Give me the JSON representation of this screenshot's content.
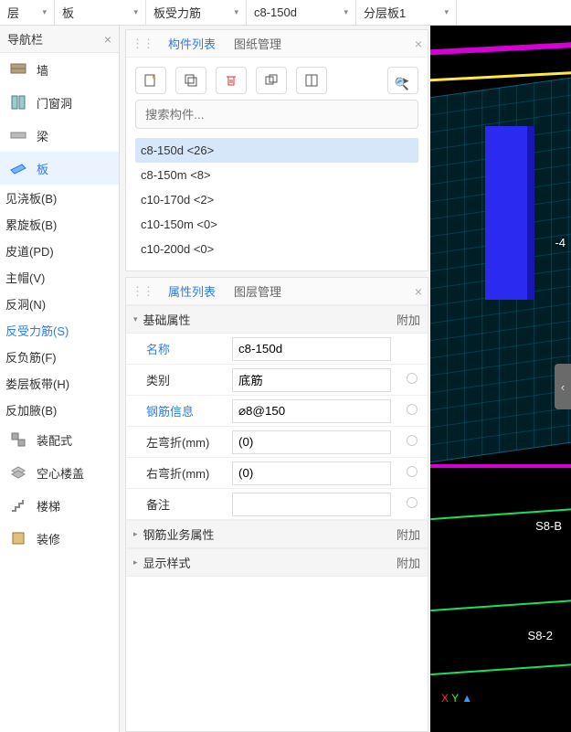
{
  "topbar": {
    "items": [
      "层",
      "板",
      "板受力筋",
      "c8-150d",
      "分层板1"
    ]
  },
  "sidebar": {
    "title": "导航栏",
    "items": [
      {
        "label": "墙",
        "icon": "wall"
      },
      {
        "label": "门窗洞",
        "icon": "door"
      },
      {
        "label": "梁",
        "icon": "beam"
      },
      {
        "label": "板",
        "icon": "slab",
        "active": true
      }
    ],
    "subs": [
      {
        "label": "见浇板(B)"
      },
      {
        "label": "累旋板(B)"
      },
      {
        "label": "皮道(PD)"
      },
      {
        "label": "主帽(V)"
      },
      {
        "label": "反洞(N)"
      },
      {
        "label": "反受力筋(S)",
        "active": true
      },
      {
        "label": "反负筋(F)"
      },
      {
        "label": "娄层板带(H)"
      },
      {
        "label": "反加腋(B)"
      }
    ],
    "lower": [
      {
        "label": "装配式",
        "icon": "prefab"
      },
      {
        "label": "空心楼盖",
        "icon": "hollow"
      },
      {
        "label": "楼梯",
        "icon": "stair"
      },
      {
        "label": "装修",
        "icon": "deco"
      }
    ]
  },
  "compPanel": {
    "tabs": [
      "构件列表",
      "图纸管理"
    ],
    "activeTab": 0,
    "searchPlaceholder": "搜索构件...",
    "items": [
      {
        "label": "c8-150d <26>",
        "selected": true
      },
      {
        "label": "c8-150m <8>"
      },
      {
        "label": "c10-170d <2>"
      },
      {
        "label": "c10-150m <0>"
      },
      {
        "label": "c10-200d <0>"
      }
    ]
  },
  "propPanel": {
    "tabs": [
      "属性列表",
      "图层管理"
    ],
    "activeTab": 0,
    "groups": [
      {
        "title": "基础属性",
        "extra": "附加",
        "open": true
      },
      {
        "title": "钢筋业务属性",
        "extra": "附加",
        "open": false
      },
      {
        "title": "显示样式",
        "extra": "附加",
        "open": false
      }
    ],
    "rows": [
      {
        "label": "名称",
        "link": true,
        "value": "c8-150d",
        "extraDot": false
      },
      {
        "label": "类别",
        "value": "底筋",
        "extraDot": true
      },
      {
        "label": "钢筋信息",
        "link": true,
        "value": "⌀8@150",
        "extraDot": true
      },
      {
        "label": "左弯折(mm)",
        "value": "(0)",
        "extraDot": true
      },
      {
        "label": "右弯折(mm)",
        "value": "(0)",
        "extraDot": true
      },
      {
        "label": "备注",
        "value": "",
        "extraDot": true
      }
    ]
  },
  "viewport": {
    "labels": [
      "-4",
      "S8-B",
      "S8-2"
    ]
  }
}
